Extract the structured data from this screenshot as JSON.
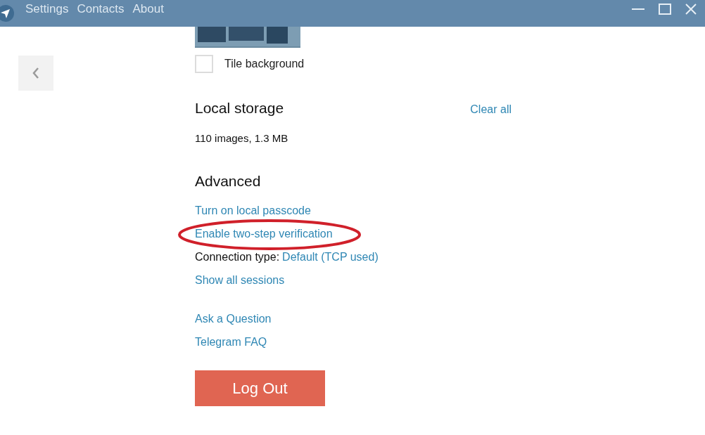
{
  "title_bar": {
    "menu": [
      "Settings",
      "Contacts",
      "About"
    ]
  },
  "background": {
    "tile": {
      "label": "Tile background",
      "checked": false
    }
  },
  "local_storage": {
    "heading": "Local storage",
    "action": "Clear all",
    "summary": "110 images, 1.3 MB"
  },
  "advanced": {
    "heading": "Advanced",
    "items": [
      {
        "kind": "link",
        "text": "Turn on local passcode",
        "highlighted": false
      },
      {
        "kind": "link",
        "text": "Enable two-step verification",
        "highlighted": true
      },
      {
        "kind": "setting",
        "label": "Connection type:",
        "value": "Default (TCP used)",
        "highlighted": false
      },
      {
        "kind": "link",
        "text": "Show all sessions",
        "highlighted": false
      }
    ]
  },
  "help_links": [
    "Ask a Question",
    "Telegram FAQ"
  ],
  "logout_button": "Log Out"
}
